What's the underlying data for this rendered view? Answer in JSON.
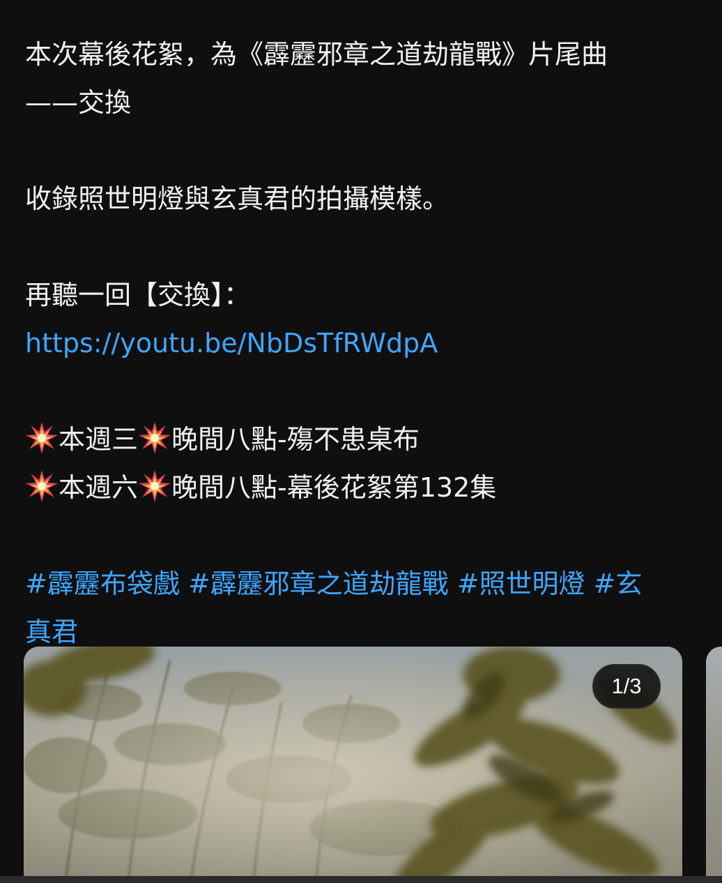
{
  "post": {
    "line1": "本次幕後花絮，為《霹靂邪章之道劫龍戰》片尾曲",
    "line2": "——交換",
    "line3": "收錄照世明燈與玄真君的拍攝模樣。",
    "line4": "再聽一回【交換】：",
    "link": "https://youtu.be/NbDsTfRWdpA",
    "schedule": [
      {
        "day": "本週三",
        "text": "晚間八點-殤不患桌布"
      },
      {
        "day": "本週六",
        "text": "晚間八點-幕後花絮第132集"
      }
    ],
    "schedule_icon": "collision-emoji-icon",
    "hashtags": {
      "tag1": "#霹靂布袋戲",
      "tag2": "#霹靂邪章之道劫龍戰",
      "tag3": "#照世明燈",
      "tag4_part1": "#玄",
      "tag4_part2": "真君"
    }
  },
  "carousel": {
    "counter": "1/3"
  },
  "colors": {
    "background": "#0f0f0f",
    "text": "#f1f1f1",
    "link": "#3ea6ff"
  }
}
